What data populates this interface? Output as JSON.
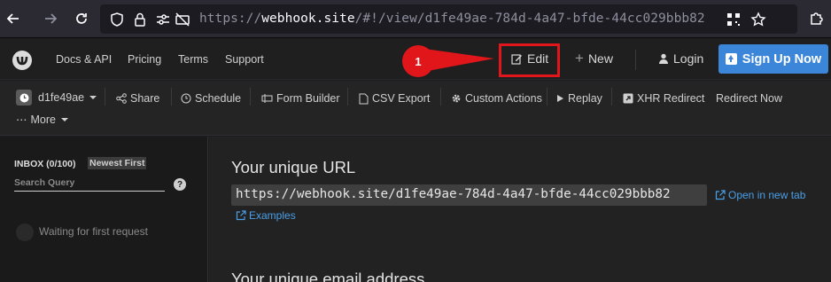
{
  "browser": {
    "url_prefix": "https://",
    "url_host": "webhook.site",
    "url_path": "/#!/view/d1fe49ae-784d-4a47-bfde-44cc029bbb82"
  },
  "navbar": {
    "links": [
      "Docs & API",
      "Pricing",
      "Terms",
      "Support"
    ],
    "edit": "Edit",
    "new": "New",
    "login": "Login",
    "signup": "Sign Up Now",
    "accent_color": "#3b86d9"
  },
  "annotation": {
    "number": "1",
    "color": "#e0161b"
  },
  "toolbar": {
    "token": "d1fe49ae",
    "share": "Share",
    "schedule": "Schedule",
    "form_builder": "Form Builder",
    "csv_export": "CSV Export",
    "custom_actions": "Custom Actions",
    "replay": "Replay",
    "xhr_redirect": "XHR Redirect",
    "redirect_now": "Redirect Now",
    "more": "More"
  },
  "sidebar": {
    "inbox": "INBOX (0/100)",
    "sort": "Newest First",
    "search_placeholder": "Search Query",
    "help": "?",
    "waiting": "Waiting for first request"
  },
  "main": {
    "url_heading": "Your unique URL",
    "unique_url": "https://webhook.site/d1fe49ae-784d-4a47-bfde-44cc029bbb82",
    "open_new_tab": "Open in new tab",
    "examples": "Examples",
    "email_heading": "Your unique email address"
  }
}
